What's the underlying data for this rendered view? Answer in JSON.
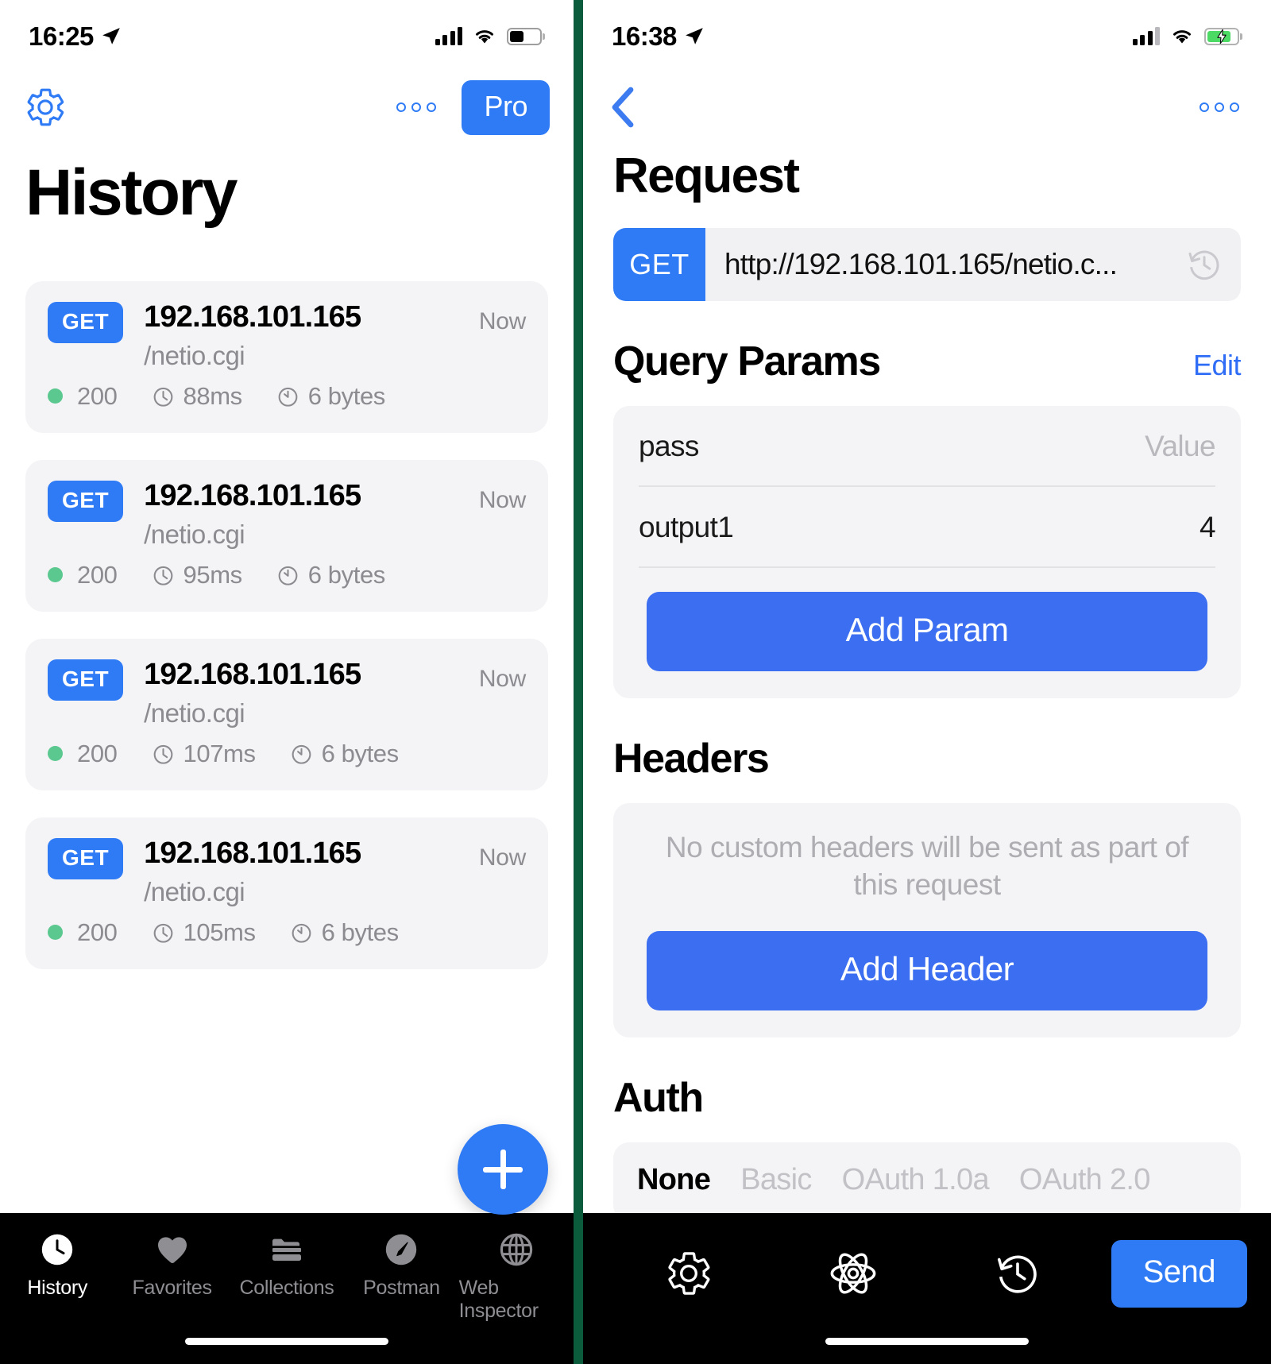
{
  "left": {
    "status": {
      "time": "16:25",
      "location_icon": "location-arrow-icon",
      "battery_state": "normal"
    },
    "nav": {
      "settings_icon": "gear-icon",
      "more_icon": "more-dots-icon",
      "pro_label": "Pro"
    },
    "title": "History",
    "history": [
      {
        "method": "GET",
        "host": "192.168.101.165",
        "path": "/netio.cgi",
        "when": "Now",
        "status": "200",
        "duration": "88ms",
        "size": "6 bytes"
      },
      {
        "method": "GET",
        "host": "192.168.101.165",
        "path": "/netio.cgi",
        "when": "Now",
        "status": "200",
        "duration": "95ms",
        "size": "6 bytes"
      },
      {
        "method": "GET",
        "host": "192.168.101.165",
        "path": "/netio.cgi",
        "when": "Now",
        "status": "200",
        "duration": "107ms",
        "size": "6 bytes"
      },
      {
        "method": "GET",
        "host": "192.168.101.165",
        "path": "/netio.cgi",
        "when": "Now",
        "status": "200",
        "duration": "105ms",
        "size": "6 bytes"
      }
    ],
    "fab": {
      "icon": "plus-icon"
    },
    "tabs": [
      {
        "label": "History",
        "icon": "clock-icon",
        "active": true
      },
      {
        "label": "Favorites",
        "icon": "heart-icon",
        "active": false
      },
      {
        "label": "Collections",
        "icon": "folder-icon",
        "active": false
      },
      {
        "label": "Postman",
        "icon": "rocket-icon",
        "active": false
      },
      {
        "label": "Web Inspector",
        "icon": "globe-icon",
        "active": false
      }
    ]
  },
  "right": {
    "status": {
      "time": "16:38",
      "location_icon": "location-arrow-icon",
      "battery_state": "charging"
    },
    "nav": {
      "back_icon": "chevron-left-icon",
      "more_icon": "more-dots-icon"
    },
    "title": "Request",
    "url_bar": {
      "method": "GET",
      "url": "http://192.168.101.165/netio.c...",
      "history_icon": "clock-history-icon"
    },
    "query_params": {
      "title": "Query Params",
      "edit_label": "Edit",
      "rows": [
        {
          "key": "pass",
          "value": "Value",
          "is_placeholder": true
        },
        {
          "key": "output1",
          "value": "4",
          "is_placeholder": false
        }
      ],
      "add_label": "Add Param"
    },
    "headers": {
      "title": "Headers",
      "empty_text": "No custom headers will be sent as part of this request",
      "add_label": "Add Header"
    },
    "auth": {
      "title": "Auth",
      "tabs": [
        {
          "label": "None",
          "selected": true
        },
        {
          "label": "Basic",
          "selected": false
        },
        {
          "label": "OAuth 1.0a",
          "selected": false
        },
        {
          "label": "OAuth 2.0",
          "selected": false
        }
      ]
    },
    "bottom": {
      "settings_icon": "gear-icon",
      "atom_icon": "atom-icon",
      "history_icon": "clock-history-icon",
      "send_label": "Send"
    }
  },
  "colors": {
    "accent_blue": "#2f7bf6",
    "cta_blue": "#3b6ef0",
    "status_green": "#5ac88f",
    "divider_green": "#0a5c3c",
    "muted_gray": "#8b8b90",
    "card_gray": "#f4f4f6"
  }
}
